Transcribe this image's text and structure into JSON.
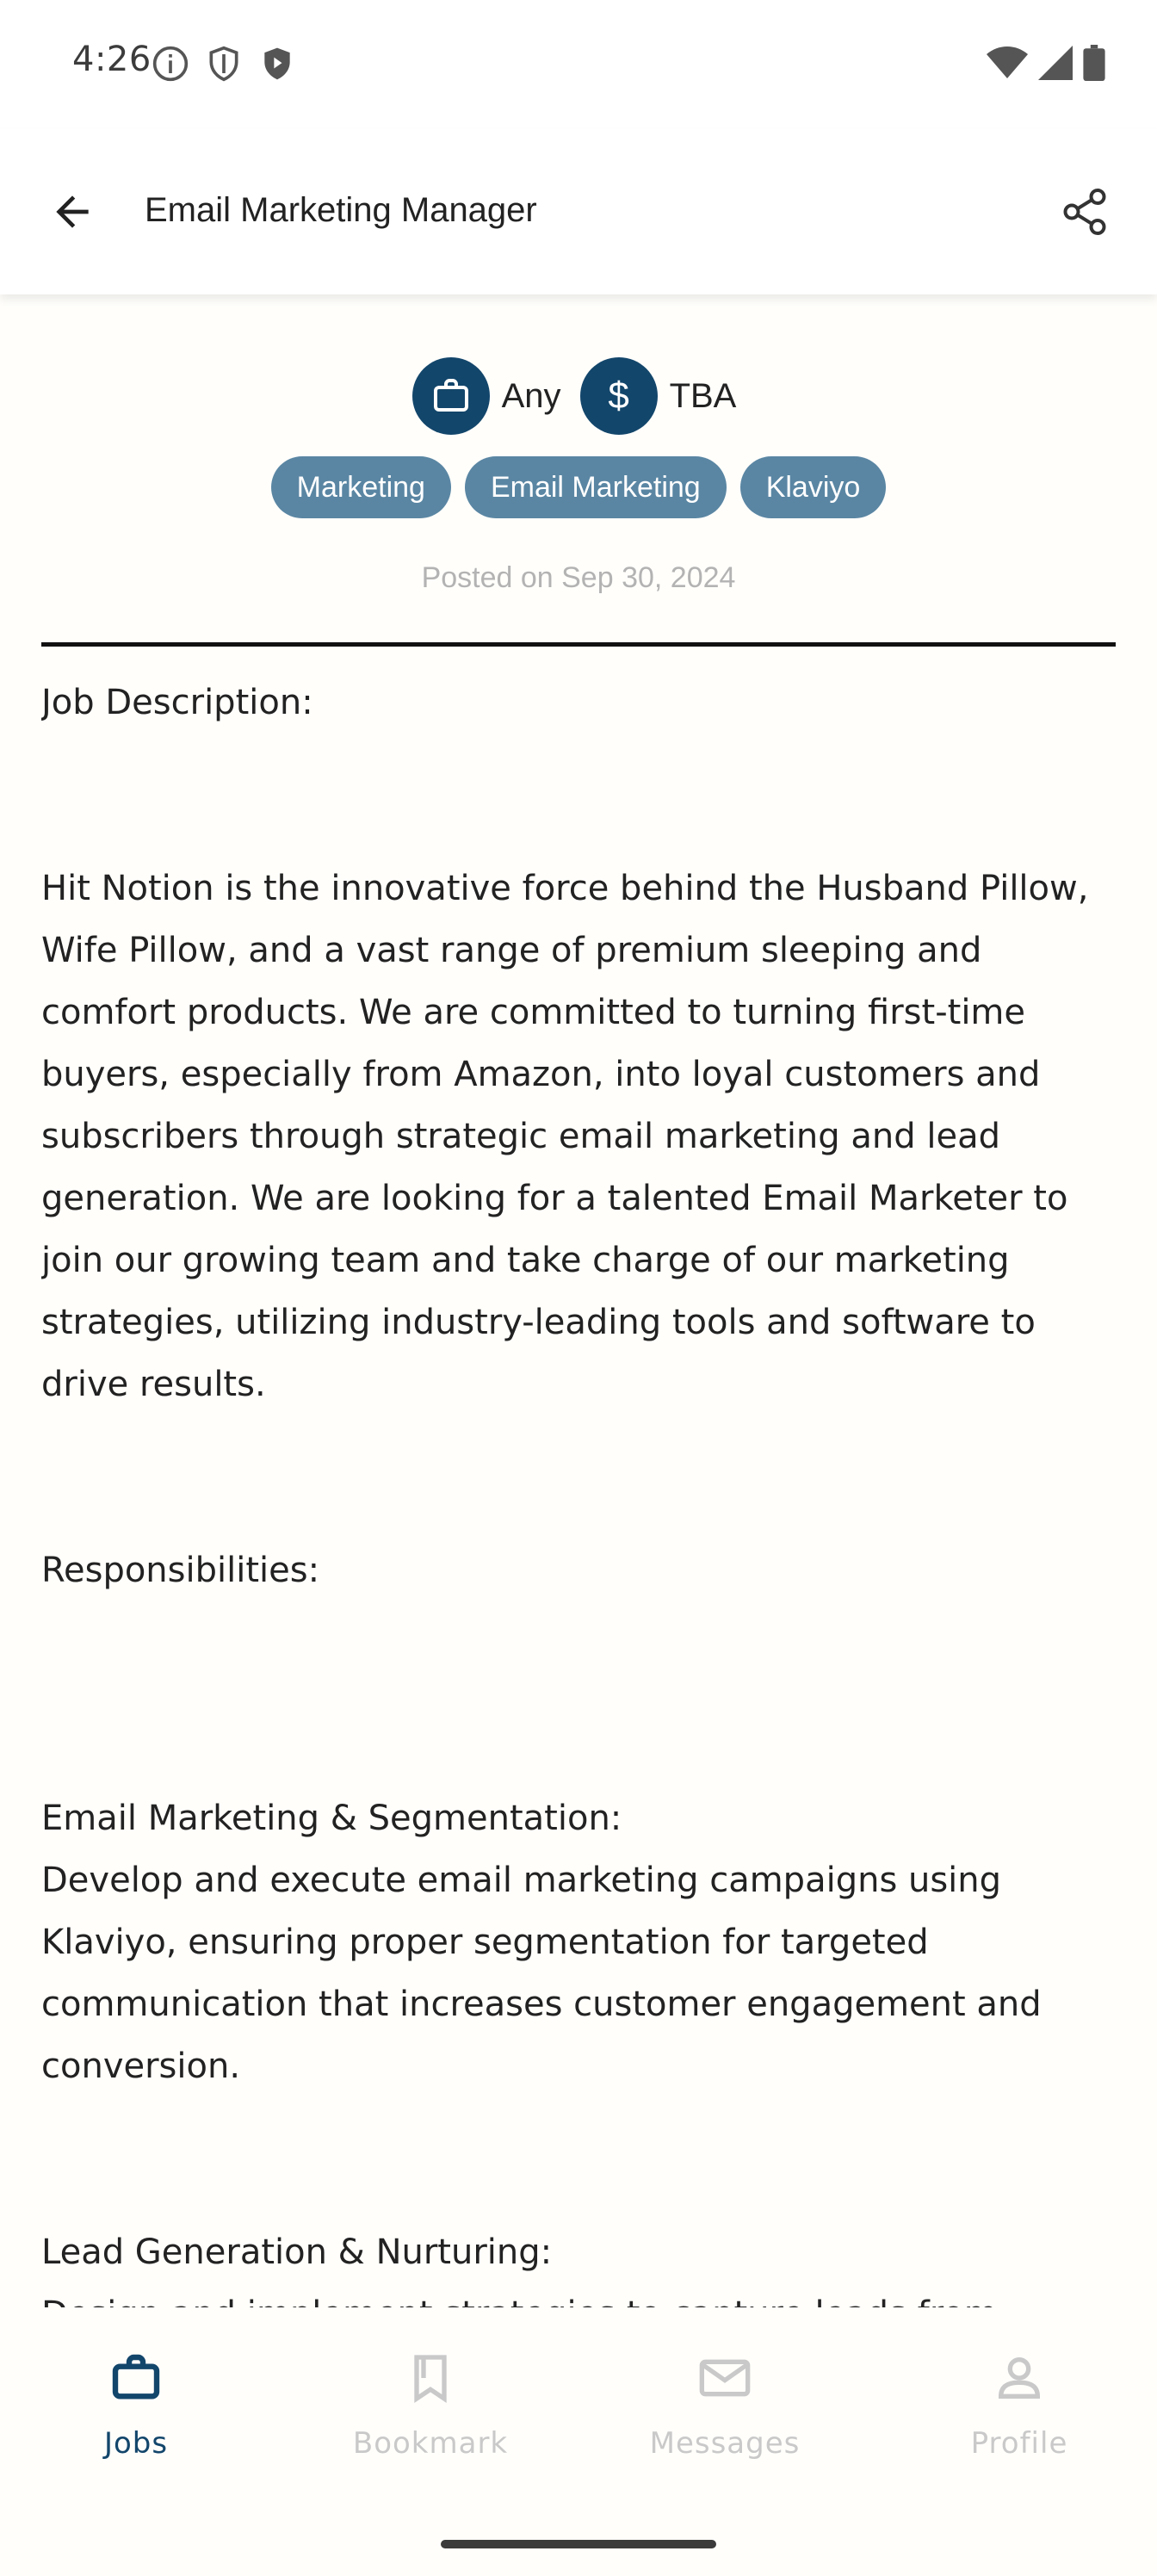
{
  "status_bar": {
    "time": "4:26"
  },
  "app_bar": {
    "title": "Email Marketing Manager"
  },
  "job_meta": {
    "type_label": "Any",
    "salary_label": "TBA",
    "tags": [
      "Marketing",
      "Email Marketing",
      "Klaviyo"
    ],
    "posted": "Posted on Sep 30, 2024"
  },
  "description": {
    "heading": "Job Description:",
    "intro": "Hit Notion is the innovative force behind the Husband Pillow, Wife Pillow, and a vast range of premium sleeping and comfort products. We are committed to turning first-time buyers, especially from Amazon, into loyal customers and subscribers through strategic email marketing and lead generation. We are looking for a talented Email Marketer to join our growing team and take charge of our marketing strategies, utilizing industry-leading tools and software to drive results.",
    "responsibilities_heading": "Responsibilities:",
    "item1_title": "Email Marketing & Segmentation:",
    "item1_body": "Develop and execute email marketing campaigns using Klaviyo, ensuring proper segmentation for targeted communication that increases customer engagement and conversion.",
    "item2_title": "Lead Generation & Nurturing:",
    "item2_body": "Design and implement strategies to capture leads from"
  },
  "bottom_nav": {
    "items": [
      {
        "label": "Jobs",
        "icon": "briefcase-icon",
        "active": true
      },
      {
        "label": "Bookmark",
        "icon": "bookmark-icon",
        "active": false
      },
      {
        "label": "Messages",
        "icon": "envelope-icon",
        "active": false
      },
      {
        "label": "Profile",
        "icon": "person-icon",
        "active": false
      }
    ]
  },
  "colors": {
    "primary": "#13466b",
    "tag_bg": "#5a86a3",
    "muted": "#c9c9c9"
  }
}
